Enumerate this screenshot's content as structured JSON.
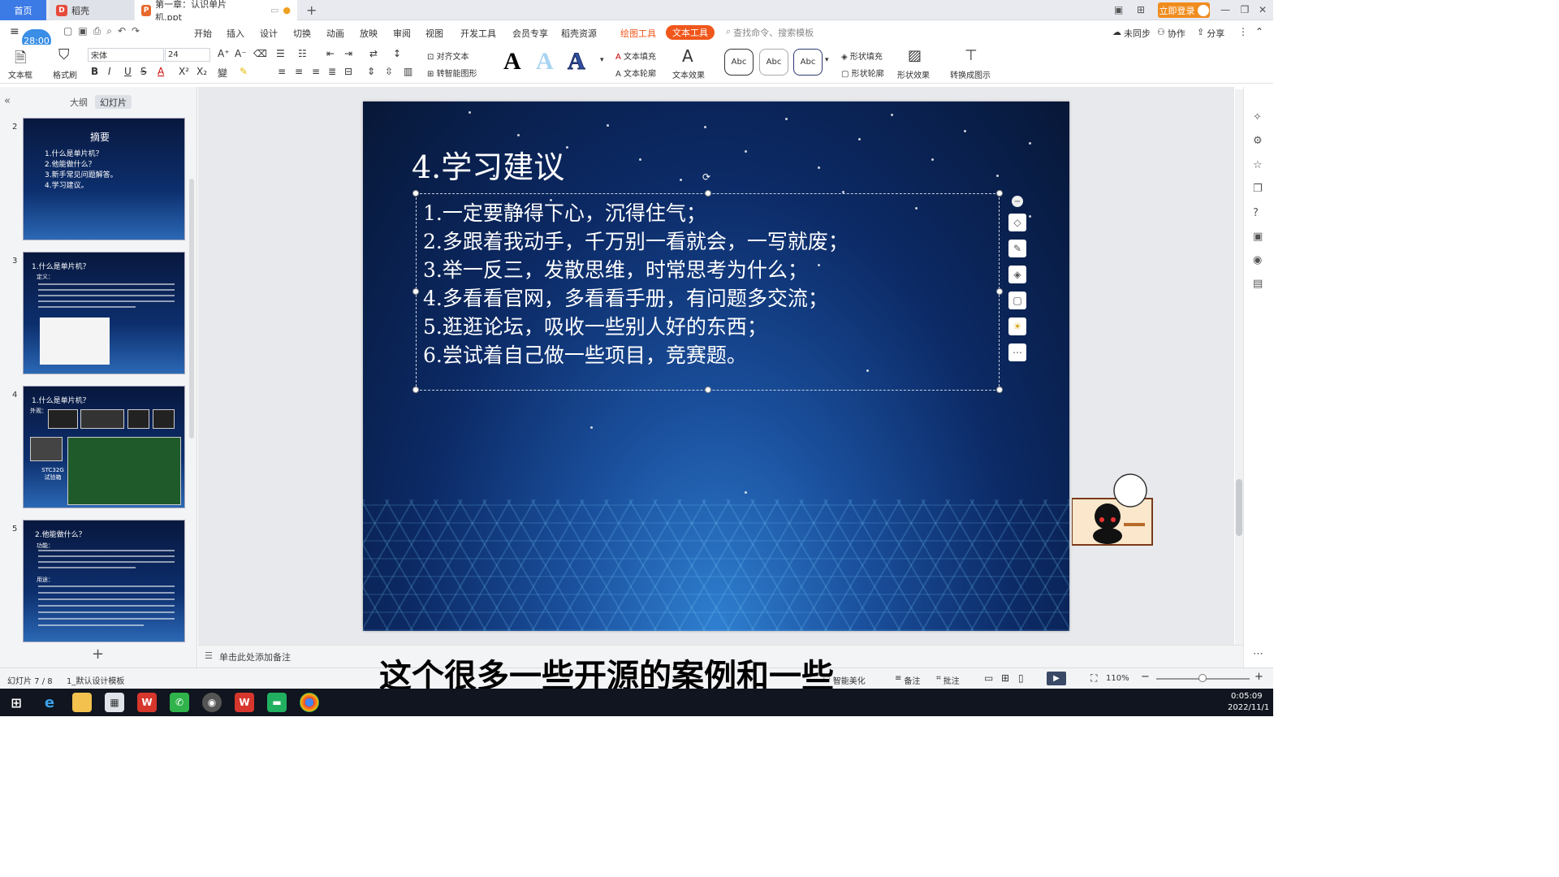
{
  "titlebar": {
    "home_tab": "首页",
    "daoke_tab": "稻壳",
    "doc_tab": "第一章：认识单片机.ppt",
    "login_button": "立即登录",
    "add_tab": "+"
  },
  "timer": "28:00",
  "menu": {
    "items": [
      "开始",
      "插入",
      "设计",
      "切换",
      "动画",
      "放映",
      "审阅",
      "视图",
      "开发工具",
      "会员专享",
      "稻壳资源"
    ],
    "drawing_tool": "绘图工具",
    "text_tool": "文本工具",
    "search_placeholder": "查找命令、搜索模板",
    "sync": "未同步",
    "collab": "协作",
    "share": "分享"
  },
  "ribbon": {
    "textbox": "文本框",
    "format_painter": "格式刷",
    "font_name": "宋体",
    "font_size": "24",
    "align_text": "对齐文本",
    "to_smartart": "转智能图形",
    "text_fill": "文本填充",
    "text_outline": "文本轮廓",
    "text_effect": "文本效果",
    "abc": [
      "Abc",
      "Abc",
      "Abc"
    ],
    "shape_fill": "形状填充",
    "shape_outline": "形状轮廓",
    "shape_effect": "形状效果",
    "convert_diagram": "转换成图示",
    "bold": "B",
    "italic": "I",
    "underline": "U",
    "strike": "S",
    "font_color": "A",
    "superscript": "X²",
    "subscript": "X₂"
  },
  "panel": {
    "outline_tab": "大纲",
    "slides_tab": "幻灯片",
    "add_slide": "+"
  },
  "thumbs": [
    {
      "num": "2",
      "title": "摘要",
      "lines": [
        "1.什么是单片机？",
        "2.他能做什么？",
        "3.新手常见问题解答。",
        "4.学习建议。"
      ]
    },
    {
      "num": "3",
      "title": "1.什么是单片机？",
      "sub": "定义："
    },
    {
      "num": "4",
      "title": "1.什么是单片机？",
      "sub": "外观：",
      "label": "STC32G 试验箱"
    },
    {
      "num": "5",
      "title": "2.他能做什么？",
      "sub": "功能：",
      "sub2": "用途："
    }
  ],
  "slide": {
    "title": "4.学习建议",
    "lines": [
      "1.一定要静得下心，沉得住气；",
      "2.多跟着我动手，千万别一看就会，一写就废；",
      "3.举一反三，发散思维，时常思考为什么；",
      "4.多看看官网，多看看手册，有问题多交流；",
      "5.逛逛论坛，吸收一些别人好的东西；",
      "6.尝试着自己做一些项目，竞赛题。"
    ]
  },
  "notes": {
    "placeholder": "单击此处添加备注"
  },
  "status": {
    "slide_count": "幻灯片 7 / 8",
    "template": "1_默认设计模板",
    "smart_beautify": "智能美化",
    "notes_btn": "备注",
    "comments_btn": "批注",
    "zoom": "110%"
  },
  "subtitle": "这个很多一些开源的案例和一些",
  "taskbar": {
    "time": "0:05:09",
    "date": "2022/11/1"
  },
  "colors": {
    "accent_blue": "#3c7ae6",
    "text_tool_orange": "#f0571c",
    "login_orange": "#f08c1e"
  }
}
